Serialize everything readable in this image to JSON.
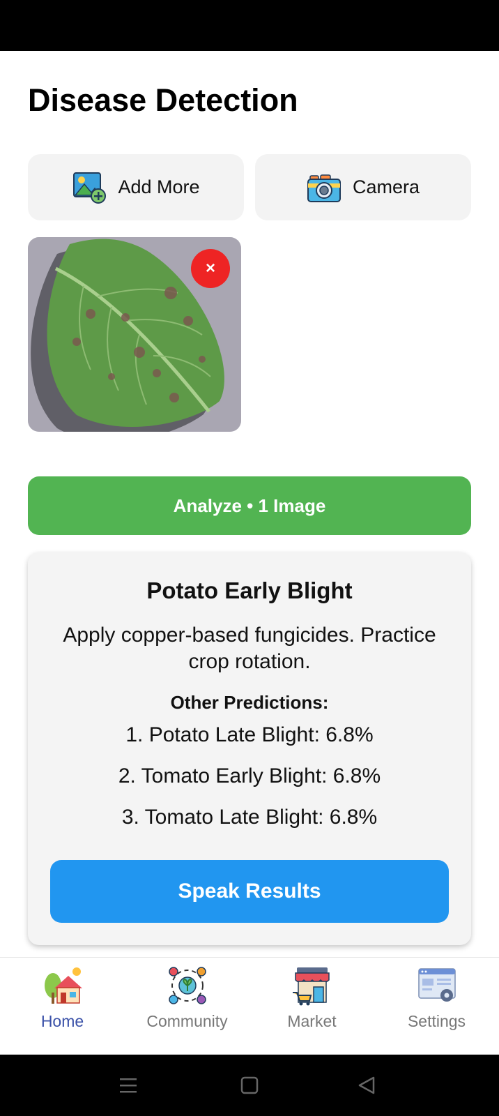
{
  "page": {
    "title": "Disease Detection"
  },
  "pickers": {
    "add_more": {
      "label": "Add More",
      "icon": "add-image-icon"
    },
    "camera": {
      "label": "Camera",
      "icon": "camera-icon"
    }
  },
  "thumbnail": {
    "remove_label": "×",
    "icon": "close-icon"
  },
  "analyze": {
    "label": "Analyze • 1 Image"
  },
  "result": {
    "title": "Potato Early Blight",
    "advice": "Apply copper-based fungicides. Practice crop rotation.",
    "other_heading": "Other Predictions:",
    "predictions": [
      "1. Potato Late Blight: 6.8%",
      "2. Tomato Early Blight: 6.8%",
      "3. Tomato Late Blight: 6.8%"
    ],
    "speak_label": "Speak Results"
  },
  "nav": {
    "items": [
      {
        "label": "Home",
        "icon": "home-icon",
        "active": true
      },
      {
        "label": "Community",
        "icon": "community-icon",
        "active": false
      },
      {
        "label": "Market",
        "icon": "market-icon",
        "active": false
      },
      {
        "label": "Settings",
        "icon": "settings-icon",
        "active": false
      }
    ]
  },
  "colors": {
    "analyze": "#52b452",
    "speak": "#2196f0",
    "remove": "#ee2424",
    "nav_active": "#3a51a8",
    "nav_inactive": "#777777"
  }
}
